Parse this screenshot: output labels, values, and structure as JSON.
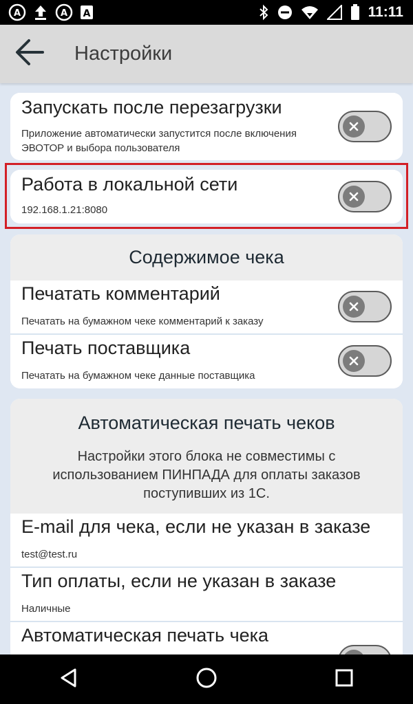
{
  "status_bar": {
    "time": "11:11",
    "icons_left": [
      "app-badge-icon",
      "upload-icon",
      "app-badge-icon",
      "text-a-icon"
    ],
    "icons_right": [
      "bluetooth-icon",
      "do-not-disturb-icon",
      "wifi-icon",
      "signal-icon",
      "battery-icon"
    ]
  },
  "app_bar": {
    "title": "Настройки",
    "back_icon": "arrow-back-icon"
  },
  "settings": {
    "autostart": {
      "title": "Запускать после перезагрузки",
      "subtitle": "Приложение автоматически запустится после включения ЭВОТОР и выбора пользователя",
      "enabled": false
    },
    "local_network": {
      "title": "Работа в локальной сети",
      "subtitle": "192.168.1.21:8080",
      "enabled": false
    },
    "receipt_content": {
      "header": "Содержимое чека",
      "print_comment": {
        "title": "Печатать комментарий",
        "subtitle": "Печатать на бумажном чеке комментарий к заказу",
        "enabled": false
      },
      "print_supplier": {
        "title": "Печать поставщика",
        "subtitle": "Печатать на бумажном чеке данные поставщика",
        "enabled": false
      }
    },
    "auto_print": {
      "header": "Автоматическая печать чеков",
      "note": "Настройки этого блока не совместимы с использованием ПИНПАДА для оплаты заказов поступивших из 1С.",
      "email": {
        "title": "E-mail для чека, если не указан в заказе",
        "value": "test@test.ru"
      },
      "payment_type": {
        "title": "Тип оплаты, если не указан в заказе",
        "value": "Наличные"
      },
      "auto_print_receipt": {
        "title": "Автоматическая печать чека",
        "enabled": false
      }
    }
  },
  "nav_bar": {
    "icons": [
      "nav-back-icon",
      "nav-home-icon",
      "nav-recents-icon"
    ]
  },
  "colors": {
    "background": "#dfe7f2",
    "card": "#ffffff",
    "appbar": "#dadada",
    "highlight": "#d31f26",
    "toggle_track": "#d6d6d6",
    "toggle_knob": "#7c7c7c"
  }
}
